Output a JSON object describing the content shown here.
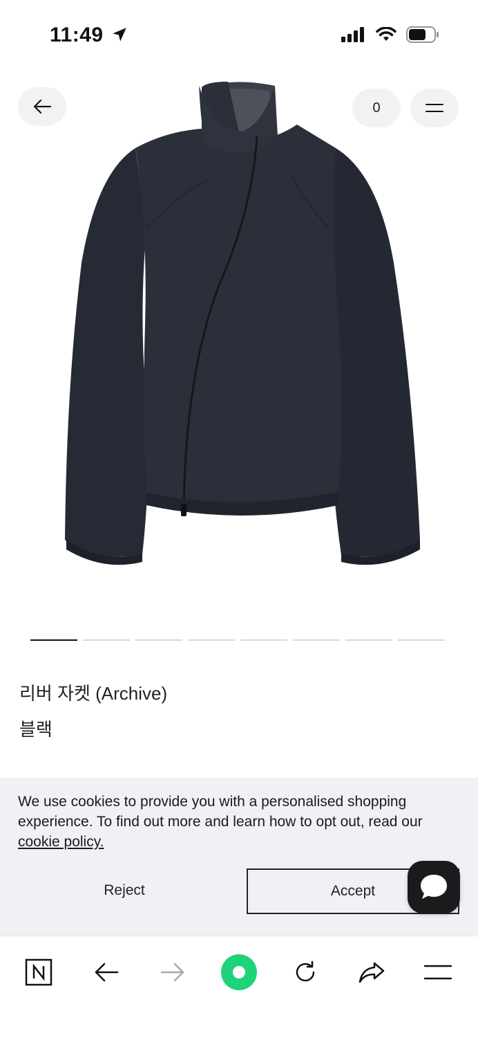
{
  "status_bar": {
    "time": "11:49",
    "icons": [
      "location-arrow-icon",
      "cellular-signal-icon",
      "wifi-icon",
      "battery-icon"
    ]
  },
  "header": {
    "back_icon": "arrow-left-icon",
    "cart_count": "0",
    "menu_icon": "hamburger-icon"
  },
  "gallery": {
    "image_subject": "navy jacket",
    "indicator_total": 8,
    "indicator_active": 1
  },
  "product": {
    "name": "리버 자켓 (Archive)",
    "color": "블랙"
  },
  "cookie_banner": {
    "text": "We use cookies to provide you with a personalised shopping experience. To find out more and learn how to opt out, read our",
    "link_text": "cookie policy.",
    "reject_label": "Reject",
    "accept_label": "Accept"
  },
  "toolbar": {
    "items": [
      "home-n-icon",
      "back-icon",
      "forward-icon",
      "green-dot-icon",
      "refresh-icon",
      "share-icon",
      "menu-icon"
    ],
    "accent_color": "#1ed37a"
  }
}
